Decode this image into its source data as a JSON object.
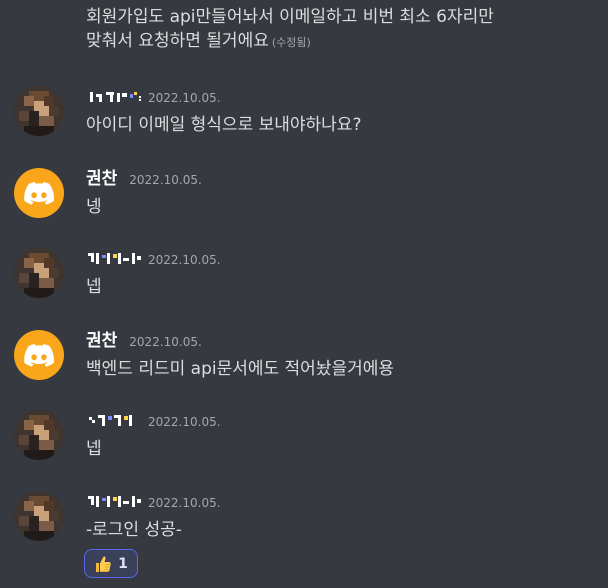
{
  "messages": {
    "first": {
      "line1": "회원가입도 api만들어놔서 이메일하고 비번 최소 6자리만",
      "line2": "맞춰서 요청하면 될거에요",
      "edited": "(수정됨)"
    },
    "m1": {
      "timestamp": "2022.10.05.",
      "text": "아이디 이메일 형식으로 보내야하나요?"
    },
    "m2": {
      "username": "권찬",
      "timestamp": "2022.10.05.",
      "text": "넹"
    },
    "m3": {
      "timestamp": "2022.10.05.",
      "text": "넵"
    },
    "m4": {
      "username": "권찬",
      "timestamp": "2022.10.05.",
      "text": "백엔드 리드미 api문서에도 적어놨을거에용"
    },
    "m5": {
      "timestamp": "2022.10.05.",
      "text": "넵"
    },
    "m6": {
      "timestamp": "2022.10.05.",
      "text": "-로그인 성공-"
    }
  },
  "reaction": {
    "emoji": "thumbs-up-icon",
    "count": "1"
  },
  "colors": {
    "background": "#36393f",
    "discord_avatar": "#faa61a",
    "reaction_border": "#5865f2",
    "reaction_bg": "#3b405a"
  }
}
